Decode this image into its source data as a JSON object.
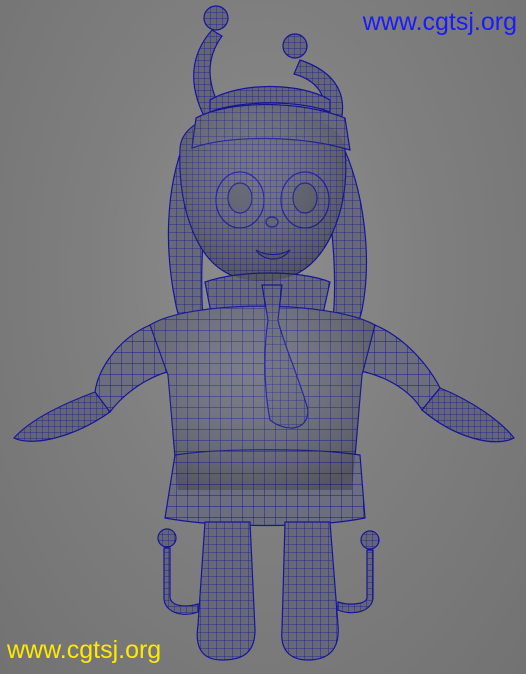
{
  "viewport": {
    "background_color": "#808080",
    "model_fill_color": "#6b6d7c",
    "wire_color": "#14149a",
    "subject": "wireframe-chibi-character-model"
  },
  "watermarks": {
    "top_right": {
      "text": "www.cgtsj.org",
      "color": "#1a1aff"
    },
    "bottom_left": {
      "text": "www.cgtsj.org",
      "color": "#ffea00"
    }
  }
}
